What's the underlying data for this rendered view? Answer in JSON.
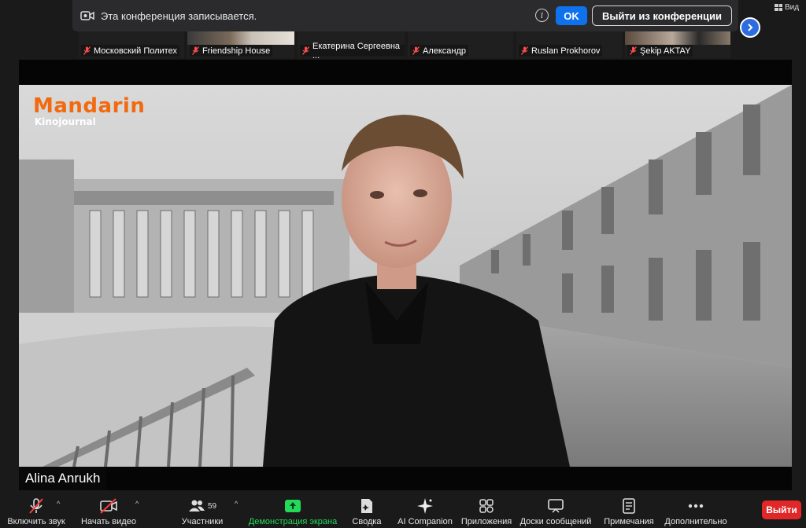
{
  "banner": {
    "recording_text": "Эта конференция записывается.",
    "ok_label": "OK",
    "leave_meeting_label": "Выйти из конференции"
  },
  "view": {
    "label": "Вид"
  },
  "participants": [
    {
      "name": "Московский Политех"
    },
    {
      "name": "Friendship House"
    },
    {
      "name": "Екатерина Сергеевна ..."
    },
    {
      "name": "Александр"
    },
    {
      "name": "Ruslan Prokhorov"
    },
    {
      "name": "Şekip AKTAY"
    }
  ],
  "video": {
    "logo_main": "Mandarin",
    "logo_sub": "Kinojournal",
    "speaker_name": "Alina Anrukh"
  },
  "toolbar": {
    "unmute": "Включить звук",
    "start_video": "Начать видео",
    "participants": "Участники",
    "participants_count": "59",
    "share_screen": "Демонстрация экрана",
    "summary": "Сводка",
    "ai_companion": "AI Companion",
    "apps": "Приложения",
    "whiteboards": "Доски сообщений",
    "notes": "Примечания",
    "more": "Дополнительно",
    "leave": "Выйти"
  },
  "colors": {
    "accent_blue": "#0e72ed",
    "share_green": "#23d959",
    "leave_red": "#e02828",
    "logo_orange": "#f26a10"
  }
}
